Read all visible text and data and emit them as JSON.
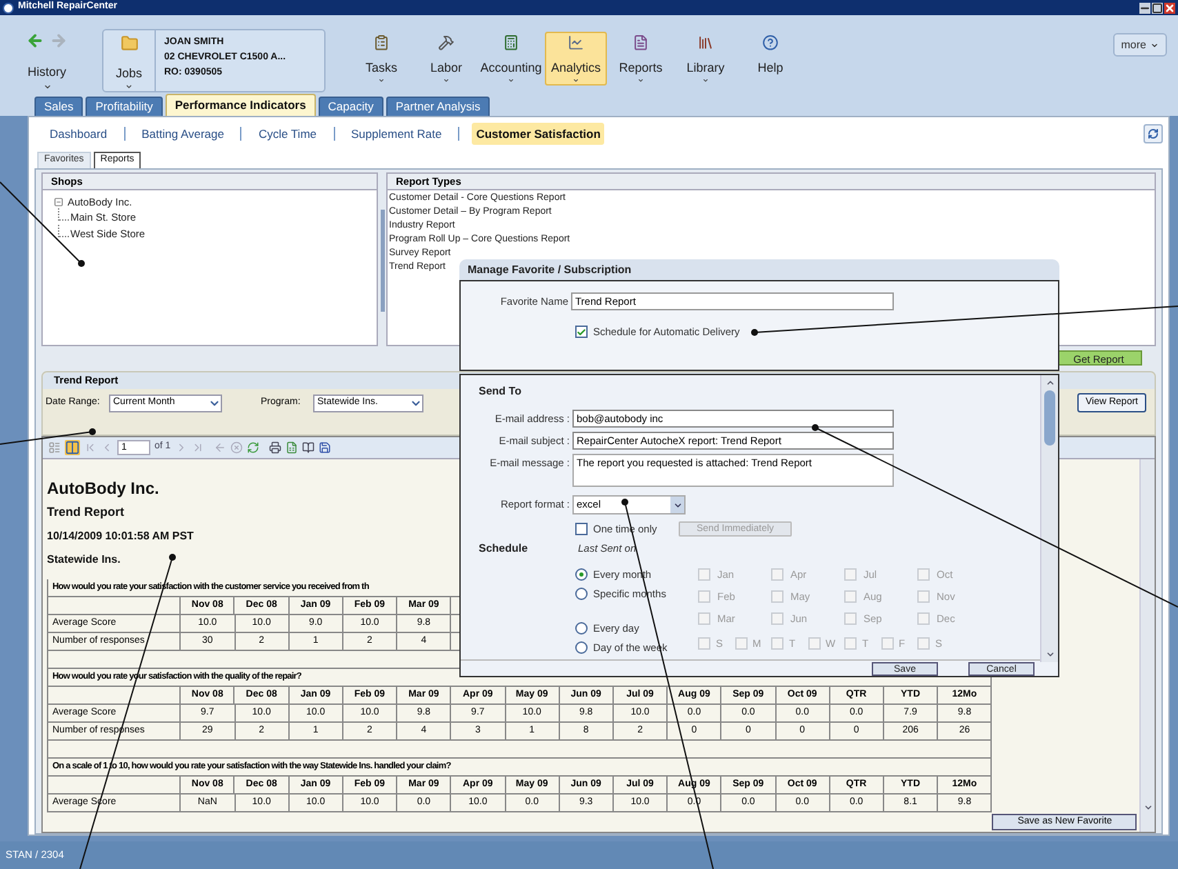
{
  "window": {
    "title": "Mitchell RepairCenter"
  },
  "toolbar": {
    "history": {
      "label": "History",
      "menu": true
    },
    "job": {
      "label": "Jobs",
      "menu": true,
      "customer": "JOAN SMITH",
      "vehicle": "02 CHEVROLET C1500 A...",
      "ro": "RO: 0390505"
    },
    "items": [
      {
        "label": "Tasks",
        "menu": true,
        "selected": false
      },
      {
        "label": "Labor",
        "menu": true,
        "selected": false
      },
      {
        "label": "Accounting",
        "menu": true,
        "selected": false
      },
      {
        "label": "Analytics",
        "menu": true,
        "selected": true
      },
      {
        "label": "Reports",
        "menu": true,
        "selected": false
      },
      {
        "label": "Library",
        "menu": true,
        "selected": false
      },
      {
        "label": "Help",
        "menu": false,
        "selected": false
      }
    ],
    "more": "more"
  },
  "tabs": [
    {
      "label": "Sales",
      "selected": false
    },
    {
      "label": "Profitability",
      "selected": false
    },
    {
      "label": "Performance Indicators",
      "selected": true
    },
    {
      "label": "Capacity",
      "selected": false
    },
    {
      "label": "Partner Analysis",
      "selected": false
    }
  ],
  "subnav": [
    {
      "label": "Dashboard",
      "selected": false
    },
    {
      "label": "Batting Average",
      "selected": false
    },
    {
      "label": "Cycle Time",
      "selected": false
    },
    {
      "label": "Supplement Rate",
      "selected": false
    },
    {
      "label": "Customer Satisfaction",
      "selected": true
    }
  ],
  "view_tabs": [
    {
      "label": "Favorites",
      "selected": false
    },
    {
      "label": "Reports",
      "selected": true
    }
  ],
  "shops": {
    "title": "Shops",
    "tree": [
      {
        "label": "AutoBody Inc.",
        "expanded": true,
        "children": [
          {
            "label": "Main St. Store"
          },
          {
            "label": "West Side Store"
          }
        ]
      }
    ]
  },
  "report_types": {
    "title": "Report Types",
    "items": [
      "Customer Detail - Core Questions Report",
      "Customer Detail – By Program Report",
      "Industry Report",
      "Program Roll Up – Core Questions Report",
      "Survey Report",
      "Trend Report"
    ]
  },
  "get_report": "Get Report",
  "trend_report": {
    "title": "Trend Report",
    "date_range_label": "Date Range:",
    "date_range": "Current Month",
    "program_label": "Program:",
    "program": "Statewide Ins.",
    "view_report": "View Report"
  },
  "report_toolbar": {
    "page": "1",
    "page_count": "of 1"
  },
  "report": {
    "company": "AutoBody Inc.",
    "title": "Trend Report",
    "timestamp": "10/14/2009 10:01:58 AM PST",
    "program": "Statewide Ins.",
    "questions": [
      {
        "question": "How would you rate your satisfaction with the customer service you received from th",
        "columns": [
          "Nov 08",
          "Dec 08",
          "Jan 09",
          "Feb 09",
          "Mar 09"
        ],
        "rows": [
          {
            "label": "Average Score",
            "values": [
              "10.0",
              "10.0",
              "9.0",
              "10.0",
              "9.8"
            ]
          },
          {
            "label": "Number of responses",
            "values": [
              "30",
              "2",
              "1",
              "2",
              "4"
            ]
          }
        ]
      },
      {
        "question": "How would you rate your satisfaction with the quality of the repair?",
        "columns": [
          "Nov 08",
          "Dec 08",
          "Jan 09",
          "Feb 09",
          "Mar 09",
          "Apr 09",
          "May 09",
          "Jun 09",
          "Jul 09",
          "Aug 09",
          "Sep 09",
          "Oct 09",
          "QTR",
          "YTD",
          "12Mo"
        ],
        "rows": [
          {
            "label": "Average Score",
            "values": [
              "9.7",
              "10.0",
              "10.0",
              "10.0",
              "9.8",
              "9.7",
              "10.0",
              "9.8",
              "10.0",
              "0.0",
              "0.0",
              "0.0",
              "0.0",
              "7.9",
              "9.8"
            ]
          },
          {
            "label": "Number of responses",
            "values": [
              "29",
              "2",
              "1",
              "2",
              "4",
              "3",
              "1",
              "8",
              "2",
              "0",
              "0",
              "0",
              "0",
              "206",
              "26"
            ]
          }
        ]
      },
      {
        "question": "On a scale of 1 to 10, how would you rate your satisfaction with the way Statewide Ins. handled your claim?",
        "columns": [
          "Nov 08",
          "Dec 08",
          "Jan 09",
          "Feb 09",
          "Mar 09",
          "Apr 09",
          "May 09",
          "Jun 09",
          "Jul 09",
          "Aug 09",
          "Sep 09",
          "Oct 09",
          "QTR",
          "YTD",
          "12Mo"
        ],
        "rows": [
          {
            "label": "Average Score",
            "values": [
              "NaN",
              "10.0",
              "10.0",
              "10.0",
              "0.0",
              "10.0",
              "0.0",
              "9.3",
              "10.0",
              "0.0",
              "0.0",
              "0.0",
              "0.0",
              "8.1",
              "9.8"
            ]
          }
        ]
      }
    ]
  },
  "save_new_favorite": "Save as New Favorite",
  "status_bar": "STAN / 2304",
  "dialog": {
    "title": "Manage Favorite / Subscription",
    "favorite_name_label": "Favorite Name",
    "favorite_name": "Trend Report",
    "schedule_delivery": {
      "label": "Schedule for Automatic Delivery",
      "checked": true
    },
    "send_to_title": "Send To",
    "fields": [
      {
        "label": "E-mail address :",
        "value": "bob@autobody inc",
        "kind": "line"
      },
      {
        "label": "E-mail subject :",
        "value": "RepairCenter AutocheX report: Trend Report",
        "kind": "line"
      },
      {
        "label": "E-mail message :",
        "value": "The report you requested is attached:  Trend Report",
        "kind": "area"
      },
      {
        "label": "Report format :",
        "value": "excel",
        "kind": "select"
      }
    ],
    "one_time": {
      "label": "One time only",
      "checked": false
    },
    "send_immediately": {
      "label": "Send Immediately",
      "disabled": true
    },
    "schedule_title": "Schedule",
    "last_sent": "Last Sent on",
    "frequency": [
      {
        "label": "Every month",
        "selected": true
      },
      {
        "label": "Specific months",
        "selected": false
      },
      {
        "label": "Every day",
        "selected": false
      },
      {
        "label": "Day of the week",
        "selected": false
      }
    ],
    "months": [
      {
        "label": "Jan",
        "checked": false,
        "disabled": true
      },
      {
        "label": "Apr",
        "checked": false,
        "disabled": true
      },
      {
        "label": "Jul",
        "checked": false,
        "disabled": true
      },
      {
        "label": "Oct",
        "checked": false,
        "disabled": true
      },
      {
        "label": "Feb",
        "checked": false,
        "disabled": true
      },
      {
        "label": "May",
        "checked": false,
        "disabled": true
      },
      {
        "label": "Aug",
        "checked": false,
        "disabled": true
      },
      {
        "label": "Nov",
        "checked": false,
        "disabled": true
      },
      {
        "label": "Mar",
        "checked": false,
        "disabled": true
      },
      {
        "label": "Jun",
        "checked": false,
        "disabled": true
      },
      {
        "label": "Sep",
        "checked": false,
        "disabled": true
      },
      {
        "label": "Dec",
        "checked": false,
        "disabled": true
      }
    ],
    "weekdays": [
      {
        "label": "S",
        "checked": false,
        "disabled": true
      },
      {
        "label": "M",
        "checked": false,
        "disabled": true
      },
      {
        "label": "T",
        "checked": false,
        "disabled": true
      },
      {
        "label": "W",
        "checked": false,
        "disabled": true
      },
      {
        "label": "T",
        "checked": false,
        "disabled": true
      },
      {
        "label": "F",
        "checked": false,
        "disabled": true
      },
      {
        "label": "S",
        "checked": false,
        "disabled": true
      }
    ],
    "save": "Save",
    "cancel": "Cancel"
  }
}
